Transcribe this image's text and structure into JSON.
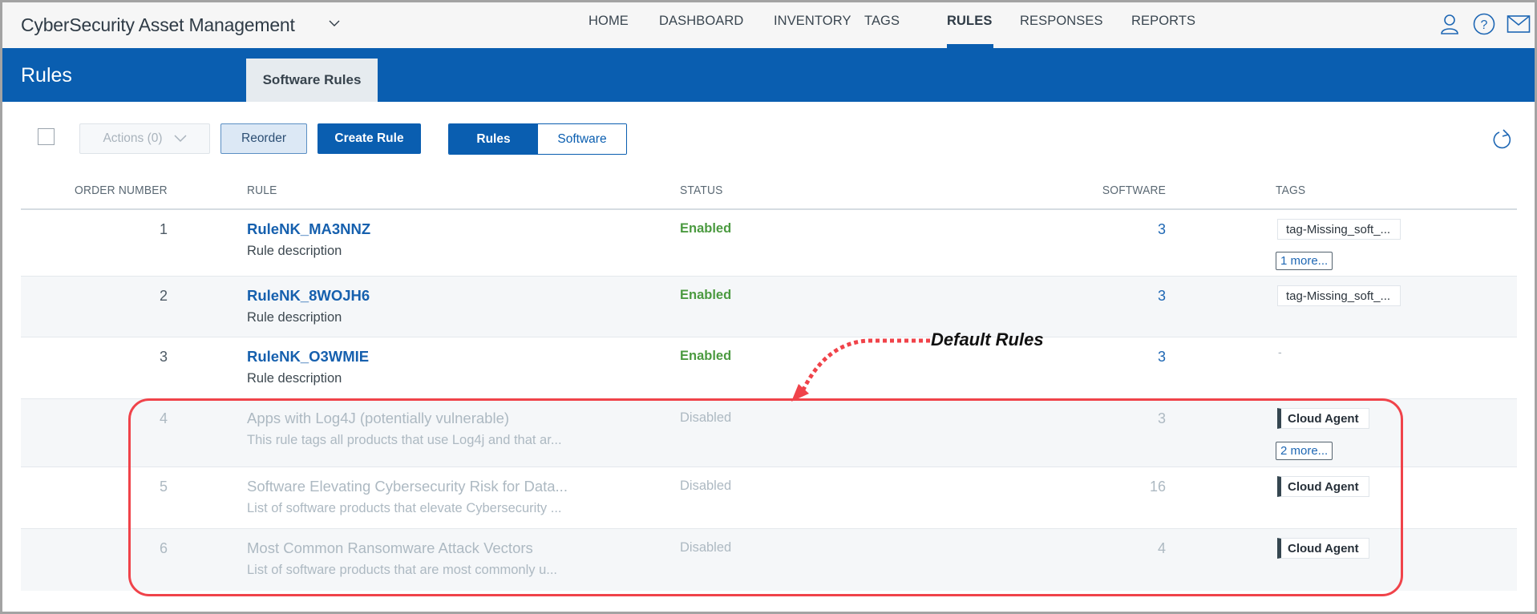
{
  "app": {
    "title": "CyberSecurity Asset Management",
    "title_chevron_icon": "chevron-down-icon"
  },
  "nav": {
    "items": [
      {
        "label": "HOME",
        "active": false
      },
      {
        "label": "DASHBOARD",
        "active": false
      },
      {
        "label": "INVENTORY",
        "active": false
      },
      {
        "label": "TAGS",
        "active": false
      },
      {
        "label": "RULES",
        "active": true
      },
      {
        "label": "RESPONSES",
        "active": false
      },
      {
        "label": "REPORTS",
        "active": false
      }
    ],
    "icons": [
      "user-icon",
      "help-icon",
      "mail-icon"
    ]
  },
  "page": {
    "title": "Rules",
    "active_tab": "Software Rules"
  },
  "toolbar": {
    "actions_label": "Actions (0)",
    "reorder_label": "Reorder",
    "create_label": "Create Rule",
    "view_toggle": {
      "selected": "Rules",
      "options": [
        "Rules",
        "Software"
      ]
    },
    "refresh_icon": "refresh-icon"
  },
  "table": {
    "columns": [
      "ORDER NUMBER",
      "RULE",
      "STATUS",
      "SOFTWARE",
      "TAGS"
    ],
    "rows": [
      {
        "order": "1",
        "name": "RuleNK_MA3NNZ",
        "description": "Rule description",
        "status": "Enabled",
        "software": "3",
        "tag": "tag-Missing_soft_...",
        "tag_style": "plain",
        "more": "1 more..."
      },
      {
        "order": "2",
        "name": "RuleNK_8WOJH6",
        "description": "Rule description",
        "status": "Enabled",
        "software": "3",
        "tag": "tag-Missing_soft_...",
        "tag_style": "plain",
        "more": null
      },
      {
        "order": "3",
        "name": "RuleNK_O3WMIE",
        "description": "Rule description",
        "status": "Enabled",
        "software": "3",
        "tag": "-",
        "tag_style": "none",
        "more": null
      },
      {
        "order": "4",
        "name": "Apps with Log4J (potentially vulnerable)",
        "description": "This rule tags all products that use Log4j and that ar...",
        "status": "Disabled",
        "software": "3",
        "tag": "Cloud Agent",
        "tag_style": "bar",
        "more": "2 more..."
      },
      {
        "order": "5",
        "name": "Software Elevating Cybersecurity Risk for Data...",
        "description": "List of software products that elevate Cybersecurity ...",
        "status": "Disabled",
        "software": "16",
        "tag": "Cloud Agent",
        "tag_style": "bar",
        "more": null
      },
      {
        "order": "6",
        "name": "Most Common Ransomware Attack Vectors",
        "description": "List of software products that are most commonly u...",
        "status": "Disabled",
        "software": "4",
        "tag": "Cloud Agent",
        "tag_style": "bar",
        "more": null
      }
    ]
  },
  "annotation": {
    "label": "Default Rules",
    "color": "#f0434a"
  },
  "colors": {
    "brand_blue": "#0a5eb0",
    "enabled_green": "#4b9a40",
    "disabled_gray": "#adb9c2"
  }
}
